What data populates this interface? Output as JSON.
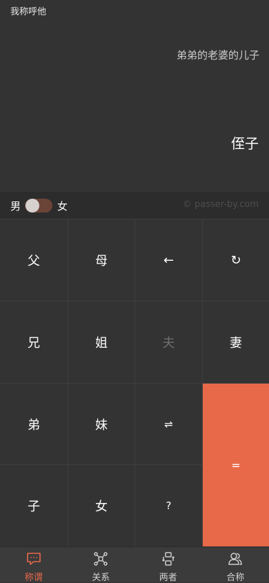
{
  "display": {
    "mode_label": "我称呼他",
    "expression": "弟弟的老婆的儿子",
    "result": "侄子"
  },
  "gender": {
    "male_label": "男",
    "female_label": "女",
    "selected": "男",
    "watermark": "© passer-by.com"
  },
  "keys": {
    "father": "父",
    "mother": "母",
    "backspace": "←",
    "reset": "↻",
    "elder_brother": "兄",
    "elder_sister": "姐",
    "husband": "夫",
    "wife": "妻",
    "younger_brother": "弟",
    "younger_sister": "妹",
    "swap": "⇌",
    "son": "子",
    "daughter": "女",
    "question": "?",
    "equals": "="
  },
  "tabs": [
    {
      "label": "称谓",
      "icon": "chat-bubble-icon",
      "active": true
    },
    {
      "label": "关系",
      "icon": "network-icon",
      "active": false
    },
    {
      "label": "两者",
      "icon": "exchange-icon",
      "active": false
    },
    {
      "label": "合称",
      "icon": "group-icon",
      "active": false
    }
  ],
  "colors": {
    "accent": "#e8694a",
    "background": "#333333",
    "divider": "#3f3f3f",
    "toggle_track": "#6b4438"
  }
}
